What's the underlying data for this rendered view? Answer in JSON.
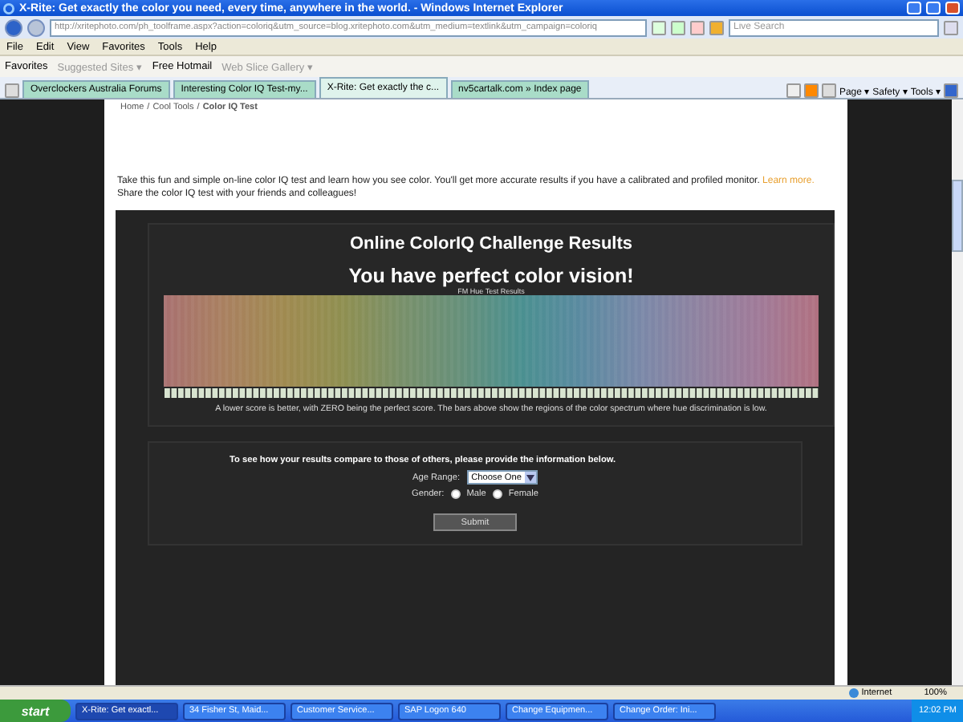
{
  "window": {
    "title": "X-Rite: Get exactly the color you need, every time, anywhere in the world. - Windows Internet Explorer"
  },
  "address": {
    "url": "http://xritephoto.com/ph_toolframe.aspx?action=coloriq&utm_source=blog.xritephoto.com&utm_medium=textlink&utm_campaign=coloriq"
  },
  "search": {
    "placeholder": "Live Search"
  },
  "menu": [
    "File",
    "Edit",
    "View",
    "Favorites",
    "Tools",
    "Help"
  ],
  "favorites_bar": [
    {
      "label": "Favorites",
      "disabled": false
    },
    {
      "label": "Suggested Sites ▾",
      "disabled": true
    },
    {
      "label": "Free Hotmail",
      "disabled": false
    },
    {
      "label": "Web Slice Gallery ▾",
      "disabled": true
    }
  ],
  "tabs": [
    {
      "label": "Overclockers Australia Forums",
      "selected": false
    },
    {
      "label": "Interesting Color IQ Test-my...",
      "selected": false
    },
    {
      "label": "X-Rite: Get exactly the c...",
      "selected": true
    },
    {
      "label": "nv5cartalk.com » Index page",
      "selected": false
    }
  ],
  "command_bar": [
    "Page ▾",
    "Safety ▾",
    "Tools ▾"
  ],
  "page": {
    "breadcrumb": [
      "Home",
      "Cool Tools",
      "Color IQ Test"
    ],
    "breadcrumb_separator": "/",
    "intro": "Take this fun and simple on-line color IQ test and learn how you see color. You'll get more accurate results if you have a calibrated and profiled monitor.",
    "intro_link": "Learn more.",
    "intro_2": "Share the color IQ test with your friends and colleagues!",
    "results_title": "Online ColorIQ Challenge Results",
    "headline": "You have perfect color vision!",
    "chart_caption": "FM Hue Test Results",
    "footnote": "A lower score is better, with ZERO being the perfect score. The bars above show the regions of the color spectrum where hue discrimination is low.",
    "form": {
      "prompt": "To see how your results compare to those of others, please provide the information below.",
      "age_label": "Age Range:",
      "age_value": "Choose One",
      "gender_label": "Gender:",
      "gender_options": [
        {
          "label": "Male",
          "selected": false
        },
        {
          "label": "Female",
          "selected": false
        }
      ],
      "submit": "Submit"
    }
  },
  "status_bar": {
    "zone": "Internet",
    "zoom": "100%"
  },
  "taskbar": {
    "start": "start",
    "items": [
      {
        "label": "X-Rite: Get exactl...",
        "selected": true
      },
      {
        "label": "34 Fisher St, Maid...",
        "selected": false
      },
      {
        "label": "Customer Service...",
        "selected": false
      },
      {
        "label": "SAP Logon 640",
        "selected": false
      },
      {
        "label": "Change Equipmen...",
        "selected": false
      },
      {
        "label": "Change Order: Ini...",
        "selected": false
      }
    ],
    "clock": "12:02 PM"
  }
}
